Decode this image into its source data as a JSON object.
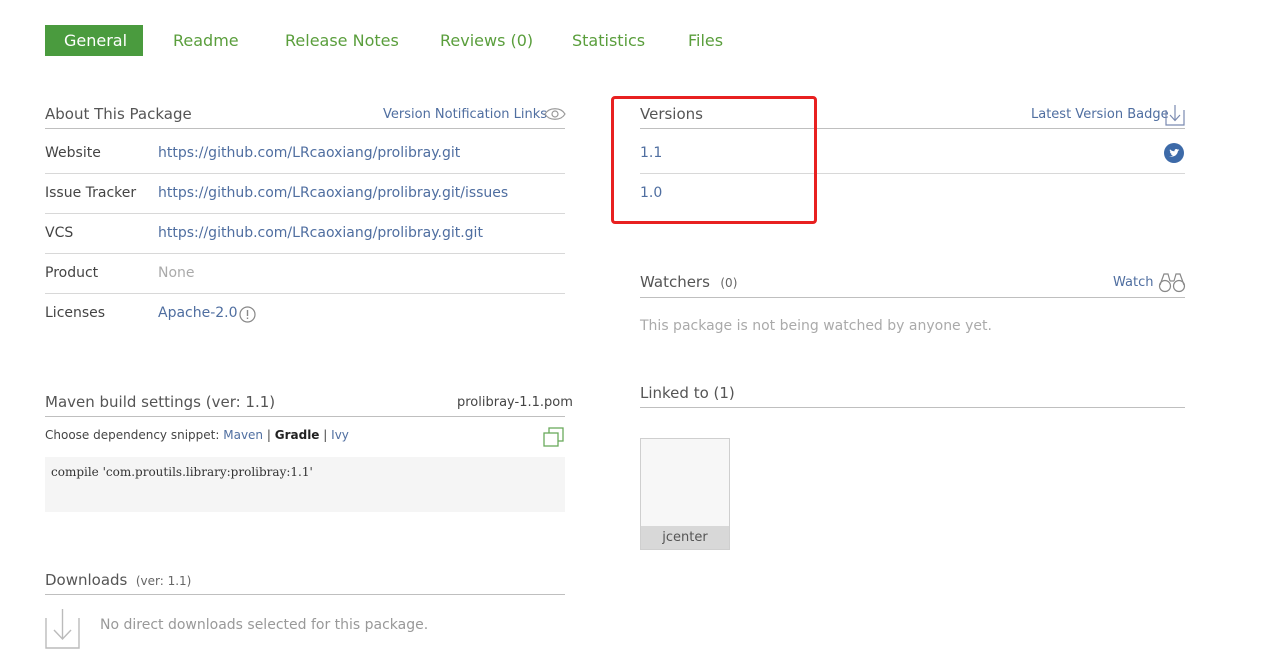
{
  "tabs": [
    {
      "label": "General",
      "active": true
    },
    {
      "label": "Readme"
    },
    {
      "label": "Release Notes"
    },
    {
      "label": "Reviews (0)"
    },
    {
      "label": "Statistics"
    },
    {
      "label": "Files"
    }
  ],
  "about": {
    "title": "About This Package",
    "notification_links": "Version Notification Links",
    "rows": [
      {
        "label": "Website",
        "value": "https://github.com/LRcaoxiang/prolibray.git"
      },
      {
        "label": "Issue Tracker",
        "value": "https://github.com/LRcaoxiang/prolibray.git/issues"
      },
      {
        "label": "VCS",
        "value": "https://github.com/LRcaoxiang/prolibray.git.git"
      },
      {
        "label": "Product",
        "value": "None"
      },
      {
        "label": "Licenses",
        "value": "Apache-2.0"
      }
    ]
  },
  "maven": {
    "title": "Maven build settings (ver: 1.1)",
    "pom": "prolibray-1.1.pom",
    "choose_label": "Choose dependency snippet:",
    "options": [
      "Maven",
      "Gradle",
      "Ivy"
    ],
    "separator": "|",
    "snippet": "compile 'com.proutils.library:prolibray:1.1'"
  },
  "downloads": {
    "title": "Downloads",
    "ver": "(ver: 1.1)",
    "empty": "No direct downloads selected for this package."
  },
  "versions": {
    "title": "Versions",
    "badge_link": "Latest Version Badge",
    "items": [
      "1.1",
      "1.0"
    ]
  },
  "watchers": {
    "title": "Watchers",
    "count": "(0)",
    "watch_label": "Watch",
    "empty": "This package is not being watched by anyone yet."
  },
  "linked": {
    "title": "Linked to (1)",
    "repo": "jcenter"
  },
  "colors": {
    "accent_green": "#4a9b3e",
    "link_blue": "#4f6ea0",
    "highlight_red": "#e82020"
  }
}
